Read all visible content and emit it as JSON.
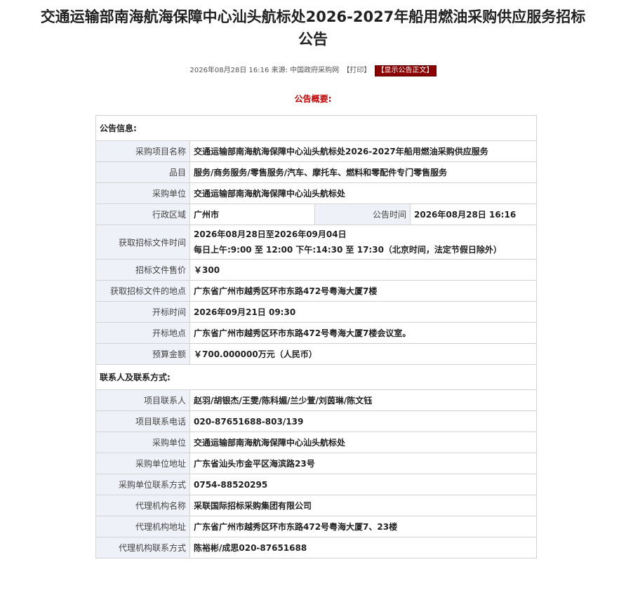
{
  "header": {
    "title_line1": "交通运输部南海航海保障中心汕头航标处2026-2027年船用燃油采购供应服务招标",
    "title_line2": "公告"
  },
  "meta": {
    "datetime": "2026年08月28日 16:16",
    "source_label": "来源:",
    "source": "中国政府采购网",
    "print_label": "【打印】",
    "show_button": "【显示公告正文】"
  },
  "summary_title": "公告概要:",
  "announcement": {
    "section_title": "公告信息:",
    "rows": [
      {
        "label": "采购项目名称",
        "value": "交通运输部南海航海保障中心汕头航标处2026-2027年船用燃油采购供应服务"
      },
      {
        "label": "品目",
        "value": "服务/商务服务/零售服务/汽车、摩托车、燃料和零配件专门零售服务"
      },
      {
        "label": "采购单位",
        "value": "交通运输部南海航海保障中心汕头航标处"
      }
    ],
    "region_label": "行政区域",
    "region_value": "广州市",
    "pubtime_label": "公告时间",
    "pubtime_value": "2026年08月28日 16:16",
    "doc_time_label": "获取招标文件时间",
    "doc_time_line1": "2026年08月28日至2026年09月04日",
    "doc_time_line2": "每日上午:9:00 至 12:00  下午:14:30 至 17:30（北京时间，法定节假日除外）",
    "rows2": [
      {
        "label": "招标文件售价",
        "value": "￥300"
      },
      {
        "label": "获取招标文件的地点",
        "value": "广东省广州市越秀区环市东路472号粤海大厦7楼"
      },
      {
        "label": "开标时间",
        "value": "2026年09月21日 09:30"
      },
      {
        "label": "开标地点",
        "value": "广东省广州市越秀区环市东路472号粤海大厦7楼会议室。"
      },
      {
        "label": "预算金额",
        "value": "￥700.000000万元（人民币）"
      }
    ]
  },
  "contacts": {
    "section_title": "联系人及联系方式:",
    "rows": [
      {
        "label": "项目联系人",
        "value": "赵羽/胡银杰/王雯/陈科媚/兰少萱/刘茵琳/陈文钰"
      },
      {
        "label": "项目联系电话",
        "value": "020-87651688-803/139"
      },
      {
        "label": "采购单位",
        "value": "交通运输部南海航海保障中心汕头航标处"
      },
      {
        "label": "采购单位地址",
        "value": "广东省汕头市金平区海滨路23号"
      },
      {
        "label": "采购单位联系方式",
        "value": "0754-88520295"
      },
      {
        "label": "代理机构名称",
        "value": "采联国际招标采购集团有限公司"
      },
      {
        "label": "代理机构地址",
        "value": "广东省广州市越秀区环市东路472号粤海大厦7、23楼"
      },
      {
        "label": "代理机构联系方式",
        "value": "陈裕彬/成思020-87651688"
      }
    ]
  }
}
